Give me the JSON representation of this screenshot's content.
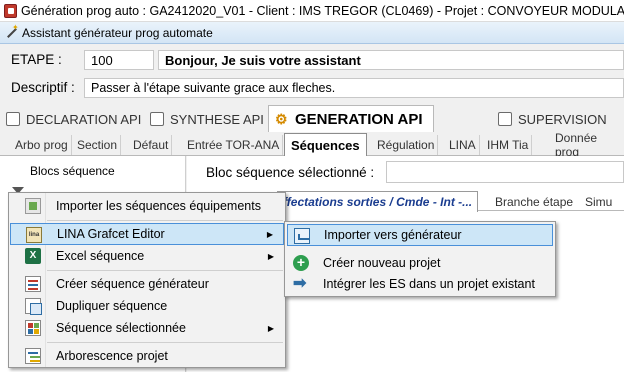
{
  "window": {
    "title": "Génération prog auto : GA2412020_V01 - Client : IMS TREGOR (CL0469) - Projet : CONVOYEUR MODULAIRE TUTO"
  },
  "assistant": {
    "label": "Assistant générateur prog automate"
  },
  "etape": {
    "label": "ETAPE :",
    "number": "100",
    "message": "Bonjour, Je suis votre assistant"
  },
  "descriptif": {
    "label": "Descriptif :",
    "value": "Passer à l'étape suivante grace aux fleches."
  },
  "main_tabs": [
    {
      "label": "DECLARATION API",
      "icon": "api-list-icon"
    },
    {
      "label": "SYNTHESE API",
      "icon": "table-icon"
    },
    {
      "label": "GENERATION API",
      "icon": "gear-icon",
      "active": true
    },
    {
      "label": "SUPERVISION",
      "icon": "table-icon"
    }
  ],
  "sub_tabs": [
    {
      "label": "Arbo prog"
    },
    {
      "label": "Section"
    },
    {
      "label": "Défaut"
    },
    {
      "label": "Entrée TOR-ANA"
    },
    {
      "label": "Séquences",
      "active": true
    },
    {
      "label": "Régulation"
    },
    {
      "label": "LINA"
    },
    {
      "label": "IHM Tia"
    },
    {
      "label": "Donnée prog"
    }
  ],
  "left_panel": {
    "header": "Blocs séquence"
  },
  "right_panel": {
    "bloc_label": "Bloc séquence sélectionné :",
    "inner_tabs": [
      {
        "label": "ffectations sorties / Cmde - Int -...",
        "active": true
      },
      {
        "label": "Branche étape"
      },
      {
        "label": "Simu"
      }
    ]
  },
  "context_menu": {
    "items": [
      {
        "label": "Importer les séquences équipements",
        "icon": "import-sequences-icon"
      },
      {
        "label": "LINA Grafcet Editor",
        "icon": "lina-icon",
        "submenu": true,
        "highlighted": true
      },
      {
        "label": "Excel séquence",
        "icon": "excel-icon",
        "submenu": true
      },
      {
        "label": "Créer séquence générateur",
        "icon": "create-sequence-icon"
      },
      {
        "label": "Dupliquer séquence",
        "icon": "duplicate-icon"
      },
      {
        "label": "Séquence sélectionnée",
        "icon": "sequence-grid-icon",
        "submenu": true
      },
      {
        "label": "Arborescence projet",
        "icon": "tree-icon"
      }
    ]
  },
  "submenu": {
    "items": [
      {
        "label": "Importer vers générateur",
        "icon": "import-to-generator-icon",
        "highlighted": true
      },
      {
        "label": "Créer nouveau projet",
        "icon": "plus-circle-icon"
      },
      {
        "label": "Intégrer les ES dans un projet existant",
        "icon": "arrow-right-icon"
      }
    ]
  },
  "colors": {
    "highlight": "#cde6f7",
    "highlight_border": "#4a90d9",
    "active_inner_tab_text": "#1a3c8f"
  }
}
